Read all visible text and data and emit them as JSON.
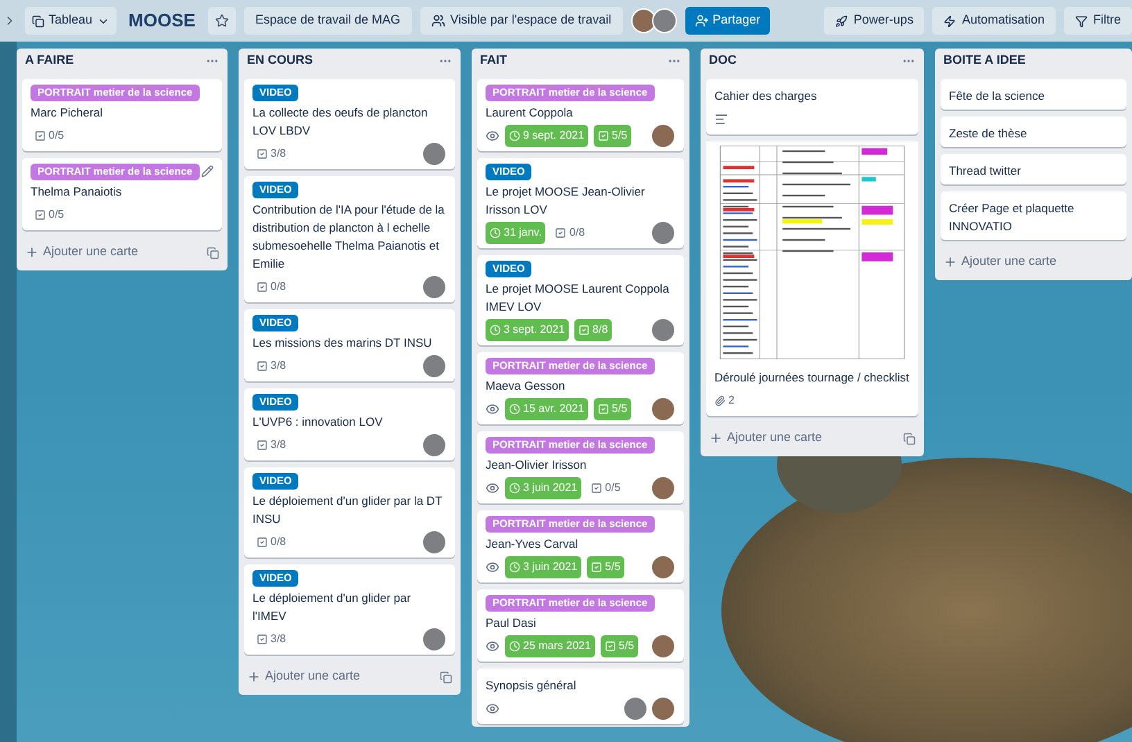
{
  "top_bar": {
    "view_button": "Tableau",
    "board_title": "MOOSE",
    "starred": false,
    "workspace": "Espace de travail de MAG",
    "visibility": "Visible par l'espace de travail",
    "avatars": [
      {
        "color": "#8a6a52"
      },
      {
        "color": "#7d7f82"
      }
    ],
    "share": "Partager",
    "right_buttons": [
      {
        "kind": "powerups",
        "label": "Power-ups"
      },
      {
        "kind": "automation",
        "label": "Automatisation"
      },
      {
        "kind": "filter",
        "label": "Filtre"
      }
    ]
  },
  "lists": [
    {
      "title": "A FAIRE",
      "menu": true,
      "template_button": true,
      "add_card": "Ajouter une carte",
      "cards": [
        {
          "label": {
            "text": "PORTRAIT metier de la science",
            "color": "#c377e0"
          },
          "title": "Marc Picheral",
          "checklist": {
            "text": "0/5",
            "done": false
          }
        },
        {
          "label": {
            "text": "PORTRAIT metier de la science",
            "color": "#c377e0"
          },
          "title": "Thelma Panaiotis",
          "edit_icon": true,
          "checklist": {
            "text": "0/5",
            "done": false
          }
        }
      ]
    },
    {
      "title": "EN COURS",
      "menu": true,
      "template_button": true,
      "add_card": "Ajouter une carte",
      "cards": [
        {
          "label": {
            "text": "VIDEO",
            "color": "#0079bf"
          },
          "title": "La collecte des oeufs de plancton LOV LBDV",
          "checklist": {
            "text": "3/8",
            "done": false
          },
          "avatars": [
            {
              "color": "#7d7f82"
            }
          ]
        },
        {
          "label": {
            "text": "VIDEO",
            "color": "#0079bf"
          },
          "title": "Contribution de l'IA pour l'étude de la distribution de plancton à l echelle submesoehelle Thelma Paianotis et Emilie",
          "checklist": {
            "text": "0/8",
            "done": false
          },
          "avatars": [
            {
              "color": "#7d7f82"
            }
          ]
        },
        {
          "label": {
            "text": "VIDEO",
            "color": "#0079bf"
          },
          "title": "Les missions des marins DT INSU",
          "checklist": {
            "text": "3/8",
            "done": false
          },
          "avatars": [
            {
              "color": "#7d7f82"
            }
          ]
        },
        {
          "label": {
            "text": "VIDEO",
            "color": "#0079bf"
          },
          "title": "L'UVP6 : innovation LOV",
          "checklist": {
            "text": "3/8",
            "done": false
          },
          "avatars": [
            {
              "color": "#7d7f82"
            }
          ]
        },
        {
          "label": {
            "text": "VIDEO",
            "color": "#0079bf"
          },
          "title": "Le déploiement d'un glider par la DT INSU",
          "checklist": {
            "text": "0/8",
            "done": false
          },
          "avatars": [
            {
              "color": "#7d7f82"
            }
          ]
        },
        {
          "label": {
            "text": "VIDEO",
            "color": "#0079bf"
          },
          "title": "Le déploiement d'un glider par l'IMEV",
          "checklist": {
            "text": "3/8",
            "done": false
          },
          "avatars": [
            {
              "color": "#7d7f82"
            }
          ]
        }
      ]
    },
    {
      "title": "FAIT",
      "menu": true,
      "cards": [
        {
          "label": {
            "text": "PORTRAIT metier de la science",
            "color": "#c377e0"
          },
          "title": "Laurent Coppola",
          "watched": true,
          "due": {
            "text": "9 sept. 2021",
            "done": true
          },
          "checklist": {
            "text": "5/5",
            "done": true
          },
          "avatars": [
            {
              "color": "#8a6a52"
            }
          ]
        },
        {
          "label": {
            "text": "VIDEO",
            "color": "#0079bf"
          },
          "title": "Le projet MOOSE Jean-Olivier Irisson LOV",
          "due": {
            "text": "31 janv.",
            "done": true
          },
          "checklist": {
            "text": "0/8",
            "done": false
          },
          "avatars": [
            {
              "color": "#7d7f82"
            }
          ]
        },
        {
          "label": {
            "text": "VIDEO",
            "color": "#0079bf"
          },
          "title": "Le projet MOOSE Laurent Coppola IMEV LOV",
          "due": {
            "text": "3 sept. 2021",
            "done": true
          },
          "checklist": {
            "text": "8/8",
            "done": true
          },
          "avatars": [
            {
              "color": "#7d7f82"
            }
          ]
        },
        {
          "label": {
            "text": "PORTRAIT metier de la science",
            "color": "#c377e0"
          },
          "title": "Maeva Gesson",
          "watched": true,
          "due": {
            "text": "15 avr. 2021",
            "done": true
          },
          "checklist": {
            "text": "5/5",
            "done": true
          },
          "avatars": [
            {
              "color": "#8a6a52"
            }
          ]
        },
        {
          "label": {
            "text": "PORTRAIT metier de la science",
            "color": "#c377e0"
          },
          "title": "Jean-Olivier Irisson",
          "watched": true,
          "due": {
            "text": "3 juin 2021",
            "done": true
          },
          "checklist": {
            "text": "0/5",
            "done": false
          },
          "avatars": [
            {
              "color": "#8a6a52"
            }
          ]
        },
        {
          "label": {
            "text": "PORTRAIT metier de la science",
            "color": "#c377e0"
          },
          "title": "Jean-Yves Carval",
          "watched": true,
          "due": {
            "text": "3 juin 2021",
            "done": true
          },
          "checklist": {
            "text": "5/5",
            "done": true
          },
          "avatars": [
            {
              "color": "#8a6a52"
            }
          ]
        },
        {
          "label": {
            "text": "PORTRAIT metier de la science",
            "color": "#c377e0"
          },
          "title": "Paul Dasi",
          "watched": true,
          "due": {
            "text": "25 mars 2021",
            "done": true
          },
          "checklist": {
            "text": "5/5",
            "done": true
          },
          "avatars": [
            {
              "color": "#8a6a52"
            }
          ]
        },
        {
          "title": "Synopsis général",
          "watched": true,
          "avatars": [
            {
              "color": "#7d7f82"
            },
            {
              "color": "#8a6a52"
            }
          ]
        }
      ]
    },
    {
      "title": "DOC",
      "menu": true,
      "template_button": true,
      "add_card": "Ajouter une carte",
      "cards": [
        {
          "title": "Cahier des charges",
          "description": true
        },
        {
          "cover": true,
          "title": "Déroulé journées tournage / checklist",
          "attachments": "2"
        }
      ]
    },
    {
      "title": "BOITE A IDEE",
      "add_card": "Ajouter une carte",
      "cards": [
        {
          "title": "Fête de la science"
        },
        {
          "title": "Zeste de thèse"
        },
        {
          "title": "Thread twitter"
        },
        {
          "title": "Créer Page et plaquette INNOVATIO"
        }
      ]
    }
  ]
}
